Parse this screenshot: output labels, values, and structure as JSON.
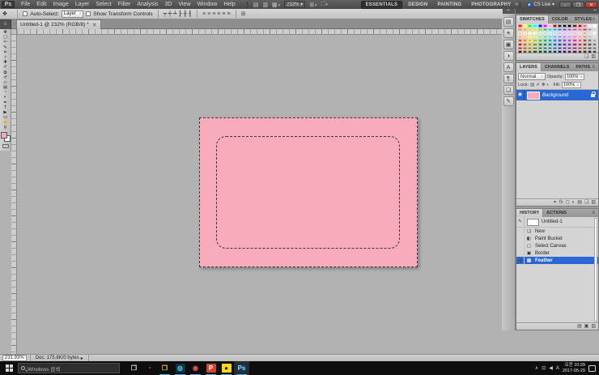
{
  "app": {
    "logo": "Ps"
  },
  "menu_bar": {
    "items": [
      "File",
      "Edit",
      "Image",
      "Layer",
      "Select",
      "Filter",
      "Analysis",
      "3D",
      "View",
      "Window",
      "Help"
    ],
    "zoom_level": "232%",
    "workspaces": [
      {
        "label": "ESSENTIALS",
        "active": true
      },
      {
        "label": "DESIGN",
        "active": false
      },
      {
        "label": "PAINTING",
        "active": false
      },
      {
        "label": "PHOTOGRAPHY",
        "active": false
      }
    ],
    "workspace_overflow": "»",
    "cs_live_label": "CS Live ▾",
    "window_controls": {
      "minimize": "–",
      "restore": "❐",
      "close": "✕"
    }
  },
  "options_bar": {
    "move_tool_glyph": "✥",
    "auto_select_label": "Auto-Select:",
    "auto_select_value": "Layer",
    "show_transform_label": "Show Transform Controls",
    "align_icons": [
      {
        "name": "align-top-edges-icon",
        "glyph": "┯"
      },
      {
        "name": "align-vertical-centers-icon",
        "glyph": "┿"
      },
      {
        "name": "align-bottom-edges-icon",
        "glyph": "┷"
      },
      {
        "name": "align-left-edges-icon",
        "glyph": "┠"
      },
      {
        "name": "align-horizontal-centers-icon",
        "glyph": "╂"
      },
      {
        "name": "align-right-edges-icon",
        "glyph": "┨"
      }
    ],
    "distribute_icons": [
      {
        "name": "distribute-top-edges-icon",
        "glyph": "≡"
      },
      {
        "name": "distribute-vertical-centers-icon",
        "glyph": "≡"
      },
      {
        "name": "distribute-bottom-edges-icon",
        "glyph": "≡"
      },
      {
        "name": "distribute-left-edges-icon",
        "glyph": "≡"
      },
      {
        "name": "distribute-horizontal-centers-icon",
        "glyph": "≡"
      },
      {
        "name": "distribute-right-edges-icon",
        "glyph": "≡"
      }
    ],
    "auto_align_glyph": "⊞"
  },
  "document_tab": {
    "title": "Untitled-1 @ 232% (RGB/8) *",
    "close_glyph": "✕"
  },
  "tools": [
    {
      "name": "move-tool",
      "glyph": "✥"
    },
    {
      "name": "rectangular-marquee-tool",
      "glyph": "▢"
    },
    {
      "name": "lasso-tool",
      "glyph": "✄"
    },
    {
      "name": "quick-selection-tool",
      "glyph": "✎"
    },
    {
      "name": "crop-tool",
      "glyph": "⌗"
    },
    {
      "name": "eyedropper-tool",
      "glyph": "✧"
    },
    {
      "name": "healing-brush-tool",
      "glyph": "✚"
    },
    {
      "name": "brush-tool",
      "glyph": "✐"
    },
    {
      "name": "clone-stamp-tool",
      "glyph": "⧉"
    },
    {
      "name": "history-brush-tool",
      "glyph": "↺"
    },
    {
      "name": "eraser-tool",
      "glyph": "▱"
    },
    {
      "name": "gradient-tool",
      "glyph": "▤"
    },
    {
      "name": "blur-tool",
      "glyph": "◔"
    },
    {
      "name": "dodge-tool",
      "glyph": "◐"
    },
    {
      "name": "pen-tool",
      "glyph": "✒"
    },
    {
      "name": "type-tool",
      "glyph": "T"
    },
    {
      "name": "path-selection-tool",
      "glyph": "▶"
    },
    {
      "name": "shape-tool",
      "glyph": "▭"
    },
    {
      "name": "hand-tool",
      "glyph": "☝"
    },
    {
      "name": "zoom-tool",
      "glyph": "⚲"
    }
  ],
  "colors": {
    "foreground": "#F8ABBB",
    "background_swatch": "#FFFFFF",
    "selection_blue": "#2a66d4",
    "canvas_fill": "#F8ABBB"
  },
  "panels": {
    "dock_icons": [
      {
        "name": "mini-bridge-panel-icon",
        "glyph": "▤"
      },
      {
        "name": "adjustments-panel-icon",
        "glyph": "☀"
      },
      {
        "name": "masks-panel-icon",
        "glyph": "▣"
      },
      {
        "name": "info-panel-icon",
        "glyph": "◑"
      },
      {
        "name": "character-panel-icon",
        "glyph": "A"
      },
      {
        "name": "paragraph-panel-icon",
        "glyph": "¶"
      },
      {
        "name": "layer-comps-panel-icon",
        "glyph": "❏"
      },
      {
        "name": "notes-panel-icon",
        "glyph": "✎"
      }
    ],
    "swatches": {
      "tabs": [
        {
          "label": "SWATCHES",
          "active": true
        },
        {
          "label": "COLOR",
          "active": false
        },
        {
          "label": "STYLES",
          "active": false
        }
      ],
      "colors": [
        "#FF0000",
        "#FFFF00",
        "#00FF00",
        "#00FFFF",
        "#0000FF",
        "#FF00FF",
        "#F8A8C0",
        "#B00000",
        "#202020",
        "#101010",
        "#000000",
        "#5A2D00",
        "#D40000",
        "#FF5FA0",
        "#E8E8E8",
        "#FFFFFF",
        "#FF6600",
        "#FF9900",
        "#FFCC00",
        "#CCE800",
        "#66CC00",
        "#00B84D",
        "#00C8C8",
        "#0099FF",
        "#3355DD",
        "#6633CC",
        "#9933CC",
        "#CC33AA",
        "#FF3399",
        "#8B4513",
        "#888888",
        "#C4C4C4",
        "#FFC6A8",
        "#FFDDAA",
        "#FFF2B3",
        "#EAF7B0",
        "#C8EFB5",
        "#B3E8CF",
        "#B3E8F0",
        "#B3D4F5",
        "#BCC0F2",
        "#D4B8F0",
        "#EAB8EE",
        "#F5B8DD",
        "#FFC6D2",
        "#D8B48C",
        "#D6D6D6",
        "#EFEFEF",
        "#FF9466",
        "#FFB84D",
        "#FFE066",
        "#D4E85C",
        "#98D968",
        "#5CC98F",
        "#4DCBD6",
        "#5CA8E8",
        "#7A88E0",
        "#A079DD",
        "#C979DD",
        "#E079BE",
        "#FF85A8",
        "#BC8F60",
        "#ABABAB",
        "#CFCFCF",
        "#E84C1E",
        "#F08A00",
        "#E8C200",
        "#A8CC14",
        "#4CB84C",
        "#22A878",
        "#00AEBE",
        "#2288DD",
        "#4C5CD4",
        "#7A55D0",
        "#AA49C8",
        "#CC4499",
        "#E0567F",
        "#A0522D",
        "#7A7A7A",
        "#A0A0A0",
        "#B42814",
        "#C06800",
        "#BA9A00",
        "#7E9A1E",
        "#238A23",
        "#1E8060",
        "#008A96",
        "#1A6AB8",
        "#2F3F9E",
        "#5A35AE",
        "#863098",
        "#A02C78",
        "#B83A5E",
        "#7E4A1E",
        "#555555",
        "#787878",
        "#8A1408",
        "#934E00",
        "#8A7200",
        "#5A7014",
        "#0F6A0F",
        "#145F49",
        "#006670",
        "#124E8A",
        "#1E2878",
        "#40207E",
        "#611E70",
        "#771E58",
        "#8A2244",
        "#5E3418",
        "#3A3A3A",
        "#5A5A5A",
        "#600000",
        "#6E3A00",
        "#645400",
        "#3F5110",
        "#0B4A0B",
        "#0E4436",
        "#004A52",
        "#0C3A66",
        "#141C5C",
        "#2E1460",
        "#481456",
        "#5E1240",
        "#6E1830",
        "#442910",
        "#262626",
        "#404040",
        "#2F4F4F",
        "#00C8D8"
      ],
      "bottom_icons": [
        {
          "name": "new-swatch-icon",
          "glyph": "❏"
        },
        {
          "name": "delete-swatch-icon",
          "glyph": "▥"
        }
      ]
    },
    "layers": {
      "tabs": [
        {
          "label": "LAYERS",
          "active": true
        },
        {
          "label": "CHANNELS",
          "active": false
        },
        {
          "label": "PATHS",
          "active": false
        }
      ],
      "blend_mode": "Normal",
      "opacity_label": "Opacity:",
      "opacity_value": "100%",
      "lock_label": "Lock:",
      "lock_icons": [
        {
          "name": "lock-transparency-icon",
          "glyph": "▨"
        },
        {
          "name": "lock-pixels-icon",
          "glyph": "✐"
        },
        {
          "name": "lock-position-icon",
          "glyph": "✥"
        },
        {
          "name": "lock-all-icon",
          "glyph": "▪"
        }
      ],
      "fill_label": "Fill:",
      "fill_value": "100%",
      "rows": [
        {
          "name": "Background",
          "active": true,
          "visible": true,
          "locked": true
        }
      ],
      "eye_glyph": "◉",
      "bottom_icons": [
        {
          "name": "link-layers-icon",
          "glyph": "⚭"
        },
        {
          "name": "layer-style-icon",
          "glyph": "fx"
        },
        {
          "name": "add-layer-mask-icon",
          "glyph": "◻"
        },
        {
          "name": "adjustment-layer-icon",
          "glyph": "◐"
        },
        {
          "name": "layer-group-icon",
          "glyph": "▤"
        },
        {
          "name": "new-layer-icon",
          "glyph": "❏"
        },
        {
          "name": "delete-layer-icon",
          "glyph": "▥"
        }
      ]
    },
    "history": {
      "tabs": [
        {
          "label": "HISTORY",
          "active": true
        },
        {
          "label": "ACTIONS",
          "active": false
        }
      ],
      "snapshot_label": "Untitled-1",
      "snapshot_source_glyph": "✎",
      "items": [
        {
          "label": "New",
          "glyph": "❏",
          "active": false
        },
        {
          "label": "Paint Bucket",
          "glyph": "◧",
          "active": false
        },
        {
          "label": "Select Canvas",
          "glyph": "▢",
          "active": false
        },
        {
          "label": "Border",
          "glyph": "▣",
          "active": false
        },
        {
          "label": "Feather",
          "glyph": "▨",
          "active": true,
          "source_glyph": "↺"
        }
      ],
      "bottom_icons": [
        {
          "name": "new-document-from-state-icon",
          "glyph": "▤"
        },
        {
          "name": "new-snapshot-icon",
          "glyph": "▣"
        },
        {
          "name": "delete-state-icon",
          "glyph": "▥"
        }
      ]
    }
  },
  "status_bar": {
    "zoom": "231.93%",
    "doc_info": "Doc: 175.8K/0 bytes",
    "arrow": "▸"
  },
  "taskbar": {
    "search_placeholder": "Windows 검색",
    "apps": [
      {
        "name": "task-view-button",
        "glyph": "❐",
        "color": "#e2e2e2",
        "bg": "transparent",
        "open": false,
        "active": false
      },
      {
        "name": "browser-app-button",
        "glyph": "◔",
        "color": "#d95858",
        "bg": "transparent",
        "open": false,
        "active": false
      },
      {
        "name": "file-explorer-button",
        "glyph": "❒",
        "color": "#f5c84b",
        "bg": "transparent",
        "open": true,
        "active": false
      },
      {
        "name": "internet-app-button",
        "glyph": "◍",
        "color": "#39c2df",
        "bg": "#173042",
        "open": true,
        "active": false
      },
      {
        "name": "chrome-button",
        "glyph": "◉",
        "color": "#e2574c",
        "bg": "transparent",
        "open": true,
        "active": false
      },
      {
        "name": "powerpoint-button",
        "glyph": "P",
        "color": "#ffffff",
        "bg": "#d04727",
        "open": true,
        "active": false
      },
      {
        "name": "kakaotalk-button",
        "glyph": "●",
        "color": "#39201d",
        "bg": "#f9d91a",
        "open": true,
        "active": false
      },
      {
        "name": "photoshop-button",
        "glyph": "Ps",
        "color": "#9fd8f7",
        "bg": "#14354d",
        "open": true,
        "active": true
      }
    ],
    "tray": {
      "chevron": "∧",
      "network_glyph": "⊡",
      "volume_glyph": "◀",
      "ime": "A",
      "time": "오전 10:29",
      "date": "2017-05-29"
    }
  }
}
